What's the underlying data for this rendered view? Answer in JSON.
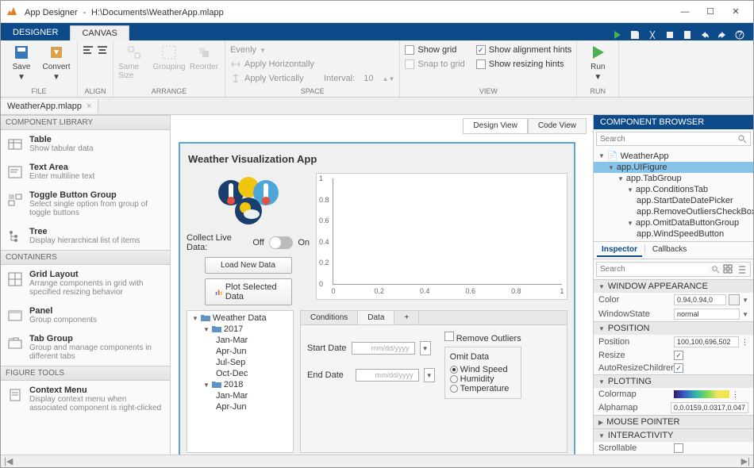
{
  "window": {
    "app": "App Designer",
    "path": "H:\\Documents\\WeatherApp.mlapp"
  },
  "main_tabs": {
    "designer": "DESIGNER",
    "canvas": "CANVAS"
  },
  "ribbon": {
    "file": {
      "label": "FILE",
      "save": "Save",
      "convert": "Convert"
    },
    "align": {
      "label": "ALIGN"
    },
    "arrange": {
      "label": "ARRANGE",
      "same": "Same Size",
      "group": "Grouping",
      "reorder": "Reorder"
    },
    "space": {
      "label": "SPACE",
      "evenly": "Evenly",
      "horiz": "Apply Horizontally",
      "vert": "Apply Vertically",
      "interval": "Interval:",
      "interval_val": "10"
    },
    "view": {
      "label": "VIEW",
      "grid": "Show grid",
      "snap": "Snap to grid",
      "align": "Show alignment hints",
      "resize": "Show resizing hints"
    },
    "run": {
      "label": "RUN",
      "run": "Run"
    }
  },
  "doc_tab": "WeatherApp.mlapp",
  "lib": {
    "title": "COMPONENT LIBRARY",
    "table": {
      "t": "Table",
      "d": "Show tabular data"
    },
    "textarea": {
      "t": "Text Area",
      "d": "Enter multiline text"
    },
    "toggle": {
      "t": "Toggle Button Group",
      "d": "Select single option from group of toggle buttons"
    },
    "tree": {
      "t": "Tree",
      "d": "Display hierarchical list of items"
    },
    "containers": "CONTAINERS",
    "grid": {
      "t": "Grid Layout",
      "d": "Arrange components in grid with specified resizing behavior"
    },
    "panel": {
      "t": "Panel",
      "d": "Group components"
    },
    "tabgroup": {
      "t": "Tab Group",
      "d": "Group and manage components in different tabs"
    },
    "figtools": "FIGURE TOOLS",
    "context": {
      "t": "Context Menu",
      "d": "Display context menu when associated component is right-clicked"
    }
  },
  "views": {
    "design": "Design View",
    "code": "Code View"
  },
  "canvas": {
    "title": "Weather Visualization App",
    "collect": "Collect Live Data:",
    "off": "Off",
    "on": "On",
    "load": "Load New Data",
    "plot": "Plot Selected Data",
    "tree_root": "Weather Data",
    "y2017": "2017",
    "y2018": "2018",
    "q": [
      "Jan-Mar",
      "Apr-Jun",
      "Jul-Sep",
      "Oct-Dec"
    ],
    "tabs": {
      "cond": "Conditions",
      "data": "Data"
    },
    "startdate": "Start Date",
    "enddate": "End Date",
    "placeholder": "mm/dd/yyyy",
    "remove": "Remove Outliers",
    "omit": "Omit Data",
    "radios": [
      "Wind Speed",
      "Humidity",
      "Temperature"
    ]
  },
  "chart_data": {
    "type": "line",
    "x": [
      0,
      0.2,
      0.4,
      0.6,
      0.8,
      1
    ],
    "y_ticks": [
      0,
      0.2,
      0.4,
      0.6,
      0.8,
      1
    ],
    "series": [],
    "xlim": [
      0,
      1
    ],
    "ylim": [
      0,
      1
    ]
  },
  "browser": {
    "title": "COMPONENT BROWSER",
    "search": "Search",
    "items": [
      "WeatherApp",
      "app.UIFigure",
      "app.TabGroup",
      "app.ConditionsTab",
      "app.StartDateDatePicker",
      "app.RemoveOutliersCheckBox",
      "app.OmitDataButtonGroup",
      "app.WindSpeedButton"
    ]
  },
  "inspector": {
    "tabs": {
      "insp": "Inspector",
      "cb": "Callbacks"
    },
    "search": "Search",
    "sec": {
      "window": "WINDOW APPEARANCE",
      "position": "POSITION",
      "plotting": "PLOTTING",
      "mouse": "MOUSE POINTER",
      "inter": "INTERACTIVITY"
    },
    "props": {
      "color": {
        "k": "Color",
        "v": "0.94,0.94,0"
      },
      "winstate": {
        "k": "WindowState",
        "v": "normal"
      },
      "position": {
        "k": "Position",
        "v": "100,100,696,502"
      },
      "resize": {
        "k": "Resize"
      },
      "autoresize": {
        "k": "AutoResizeChildren"
      },
      "colormap": {
        "k": "Colormap"
      },
      "alphamap": {
        "k": "Alphamap",
        "v": "0,0.0159,0.0317,0.047"
      },
      "scrollable": {
        "k": "Scrollable"
      }
    }
  }
}
